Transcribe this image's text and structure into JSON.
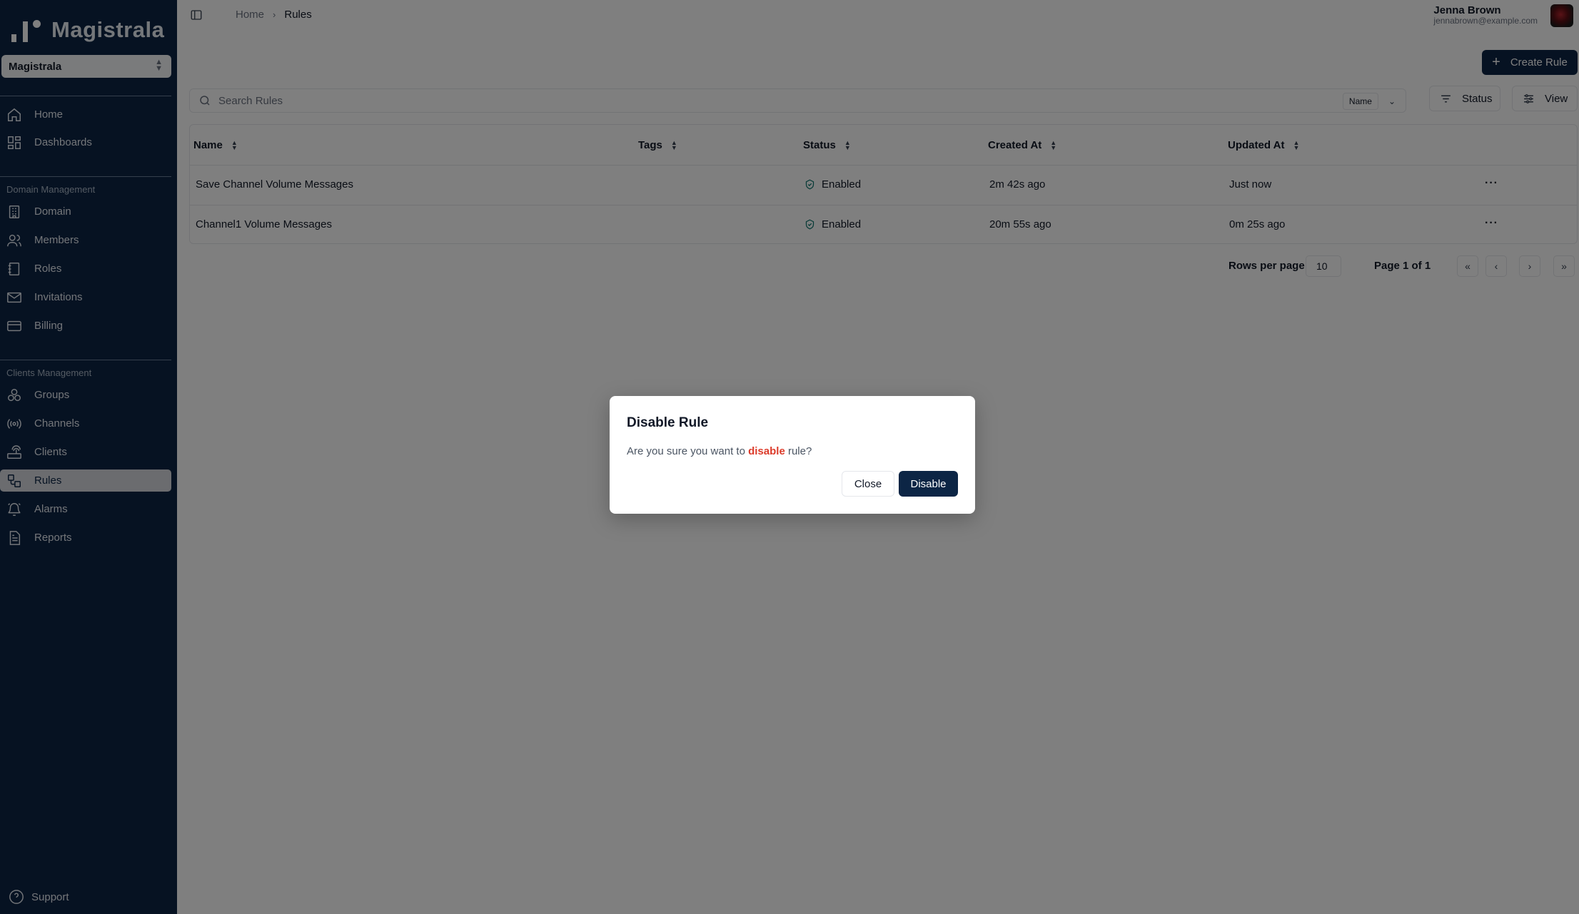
{
  "app": {
    "name": "Magistrala",
    "domain_selector": "Magistrala"
  },
  "sidebar": {
    "main_items": [
      {
        "label": "Home",
        "icon": "home-icon"
      },
      {
        "label": "Dashboards",
        "icon": "dashboards-icon"
      }
    ],
    "domain_section": {
      "heading": "Domain Management",
      "items": [
        {
          "label": "Domain",
          "icon": "building-icon"
        },
        {
          "label": "Members",
          "icon": "users-icon"
        },
        {
          "label": "Roles",
          "icon": "book-icon"
        },
        {
          "label": "Invitations",
          "icon": "mail-icon"
        },
        {
          "label": "Billing",
          "icon": "credit-card-icon"
        }
      ]
    },
    "clients_section": {
      "heading": "Clients Management",
      "items": [
        {
          "label": "Groups",
          "icon": "groups-icon"
        },
        {
          "label": "Channels",
          "icon": "radio-icon"
        },
        {
          "label": "Clients",
          "icon": "router-icon"
        },
        {
          "label": "Rules",
          "icon": "workflow-icon",
          "active": true
        },
        {
          "label": "Alarms",
          "icon": "bell-icon"
        },
        {
          "label": "Reports",
          "icon": "file-icon"
        }
      ]
    },
    "support": "Support"
  },
  "header": {
    "breadcrumb": [
      "Home",
      "Rules"
    ],
    "user_name": "Jenna Brown",
    "user_email": "jennabrown@example.com"
  },
  "toolbar": {
    "create_label": "Create Rule",
    "search_placeholder": "Search Rules",
    "sort_field": "Name",
    "status_label": "Status",
    "view_label": "View"
  },
  "table": {
    "columns": [
      "Name",
      "Tags",
      "Status",
      "Created At",
      "Updated At"
    ],
    "rows": [
      {
        "name": "Save Channel Volume Messages",
        "tags": "",
        "status": "Enabled",
        "created": "2m 42s ago",
        "updated": "Just now"
      },
      {
        "name": "Channel1 Volume Messages",
        "tags": "",
        "status": "Enabled",
        "created": "20m 55s ago",
        "updated": "0m 25s ago"
      }
    ]
  },
  "pagination": {
    "rows_per_page_label": "Rows per page",
    "rows_per_page": "10",
    "page_info": "Page 1 of 1"
  },
  "dialog": {
    "title": "Disable Rule",
    "text_before": "Are you sure you want to ",
    "text_highlight": "disable",
    "text_after": " rule?",
    "close_label": "Close",
    "confirm_label": "Disable"
  },
  "colors": {
    "sidebar_bg": "#0c2545",
    "primary": "#0c2545",
    "danger_text": "#dc3b2a",
    "status_icon": "#0f766e"
  }
}
